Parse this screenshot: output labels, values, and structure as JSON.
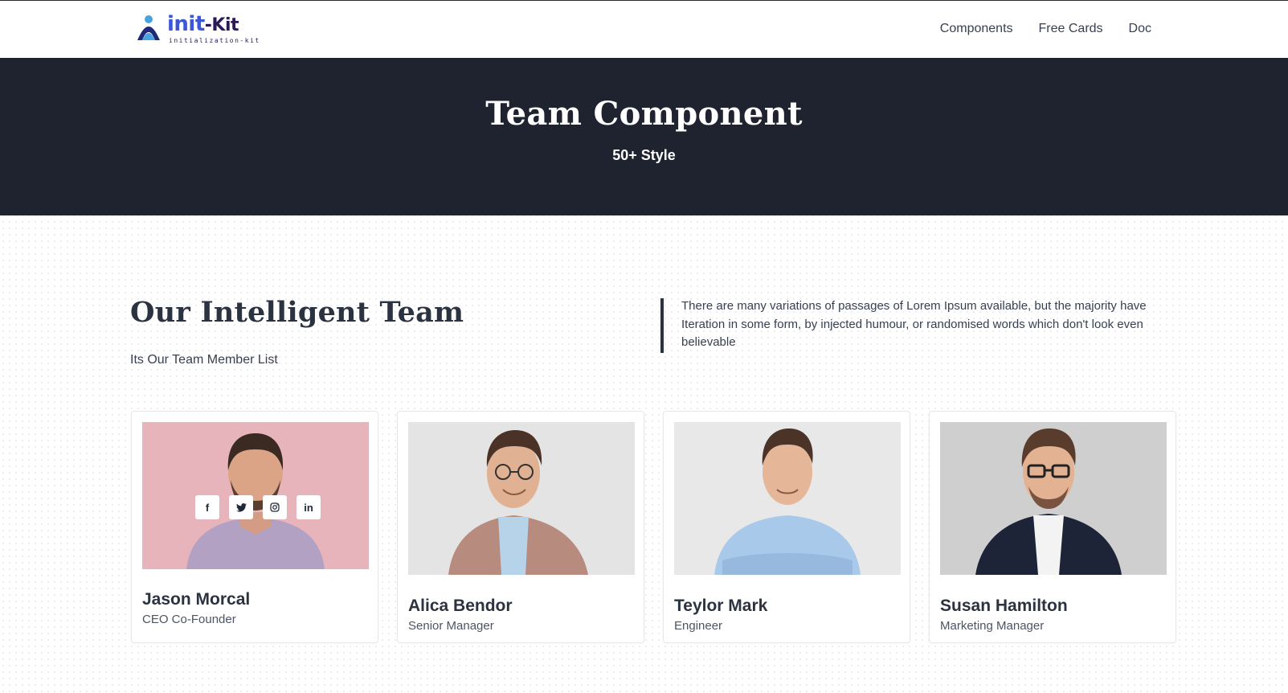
{
  "brand": {
    "logo_main": "init",
    "logo_accent": "-Kit",
    "logo_sub": "initialization-kit"
  },
  "nav": {
    "items": [
      "Components",
      "Free Cards",
      "Doc"
    ]
  },
  "hero": {
    "title": "Team Component",
    "subtitle": "50+ Style",
    "background": "#1f2330"
  },
  "section": {
    "title": "Our Intelligent Team",
    "subtitle": "Its Our Team Member List",
    "description": "There are many variations of passages of Lorem Ipsum available, but the majority have Iteration in some form, by injected humour, or randomised words which don't look even believable"
  },
  "team": [
    {
      "name": "Jason Morcal",
      "role": "CEO Co-Founder",
      "photo_bg": "#e7b4bc",
      "shirt": "#b3a1c4",
      "socials": [
        "f",
        "twitter",
        "instagram",
        "in"
      ]
    },
    {
      "name": "Alica Bendor",
      "role": "Senior Manager",
      "photo_bg": "#e4e4e4",
      "shirt": "#b88b7f"
    },
    {
      "name": "Teylor Mark",
      "role": "Engineer",
      "photo_bg": "#e8e8e8",
      "shirt": "#a9c9ea"
    },
    {
      "name": "Susan Hamilton",
      "role": "Marketing Manager",
      "photo_bg": "#cfcfcf",
      "shirt": "#1d2438"
    }
  ]
}
